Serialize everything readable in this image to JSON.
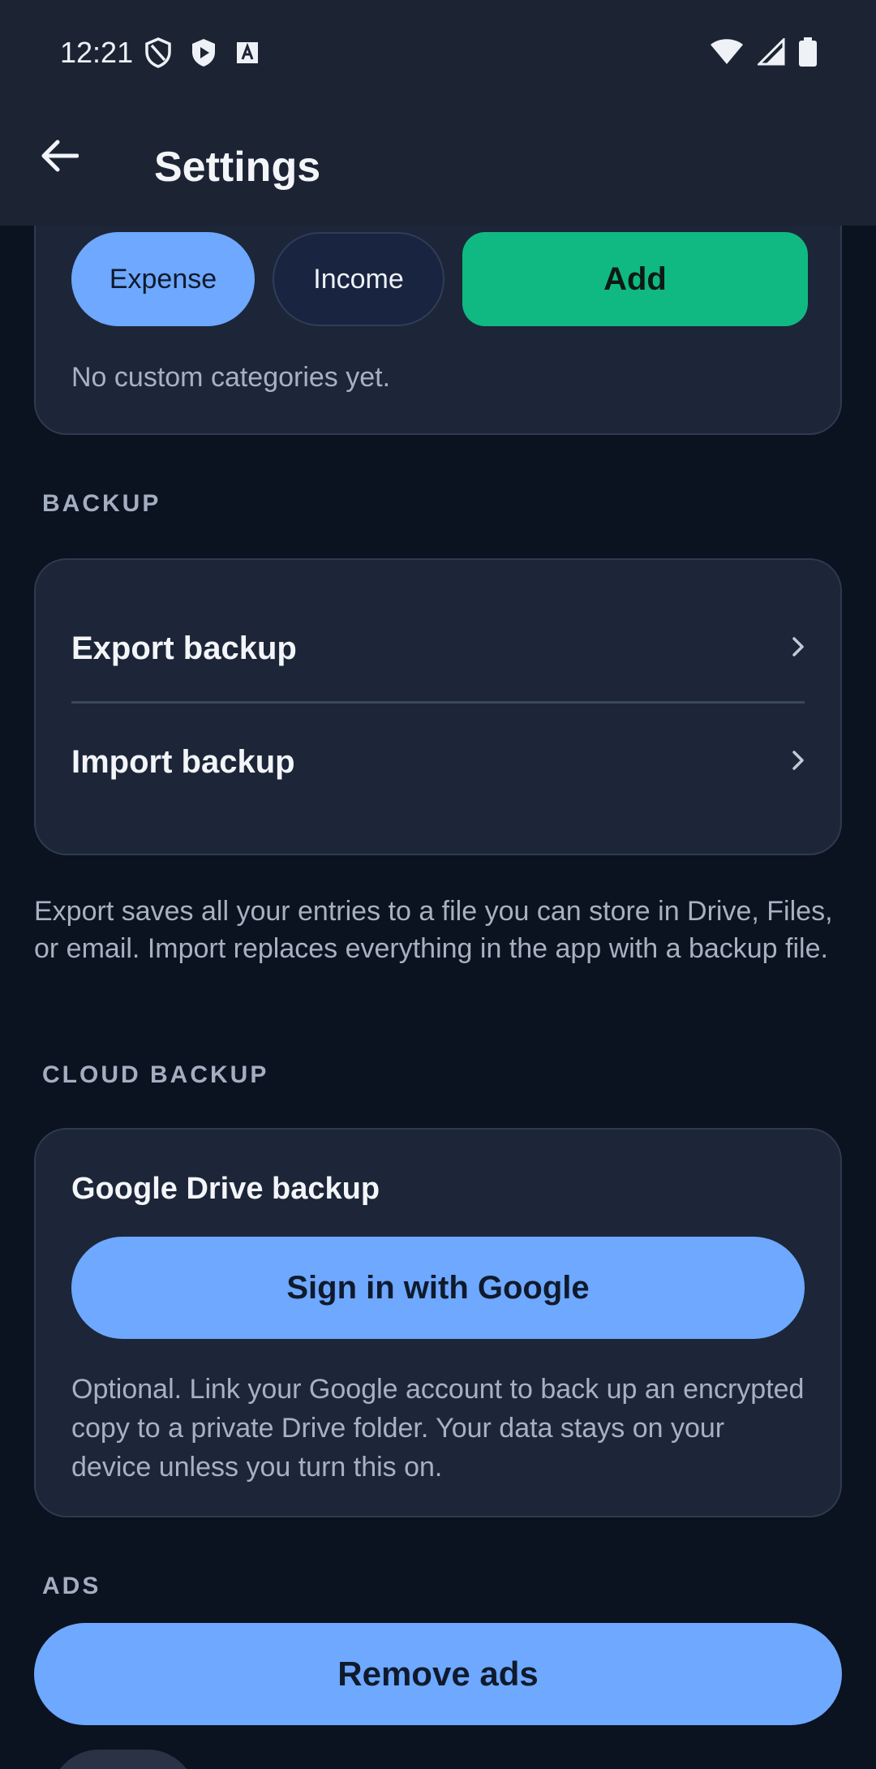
{
  "status_bar": {
    "time": "12:21"
  },
  "app_bar": {
    "title": "Settings"
  },
  "categories": {
    "expense_label": "Expense",
    "income_label": "Income",
    "add_label": "Add",
    "empty_text": "No custom categories yet."
  },
  "backup": {
    "section_label": "BACKUP",
    "items": [
      {
        "label": "Export backup"
      },
      {
        "label": "Import backup"
      }
    ],
    "helper_text": "Export saves all your entries to a file you can store in Drive, Files, or email. Import replaces everything in the app with a backup file."
  },
  "cloud_backup": {
    "section_label": "CLOUD BACKUP",
    "heading": "Google Drive backup",
    "sign_in_label": "Sign in with Google",
    "note": "Optional. Link your Google account to back up an encrypted copy to a private Drive folder. Your data stays on your device unless you turn this on."
  },
  "ads": {
    "section_label": "ADS",
    "remove_label": "Remove ads"
  },
  "colors": {
    "background": "#0b1220",
    "surface": "#1c2638",
    "primary": "#6ea8ff",
    "success": "#10b981"
  }
}
